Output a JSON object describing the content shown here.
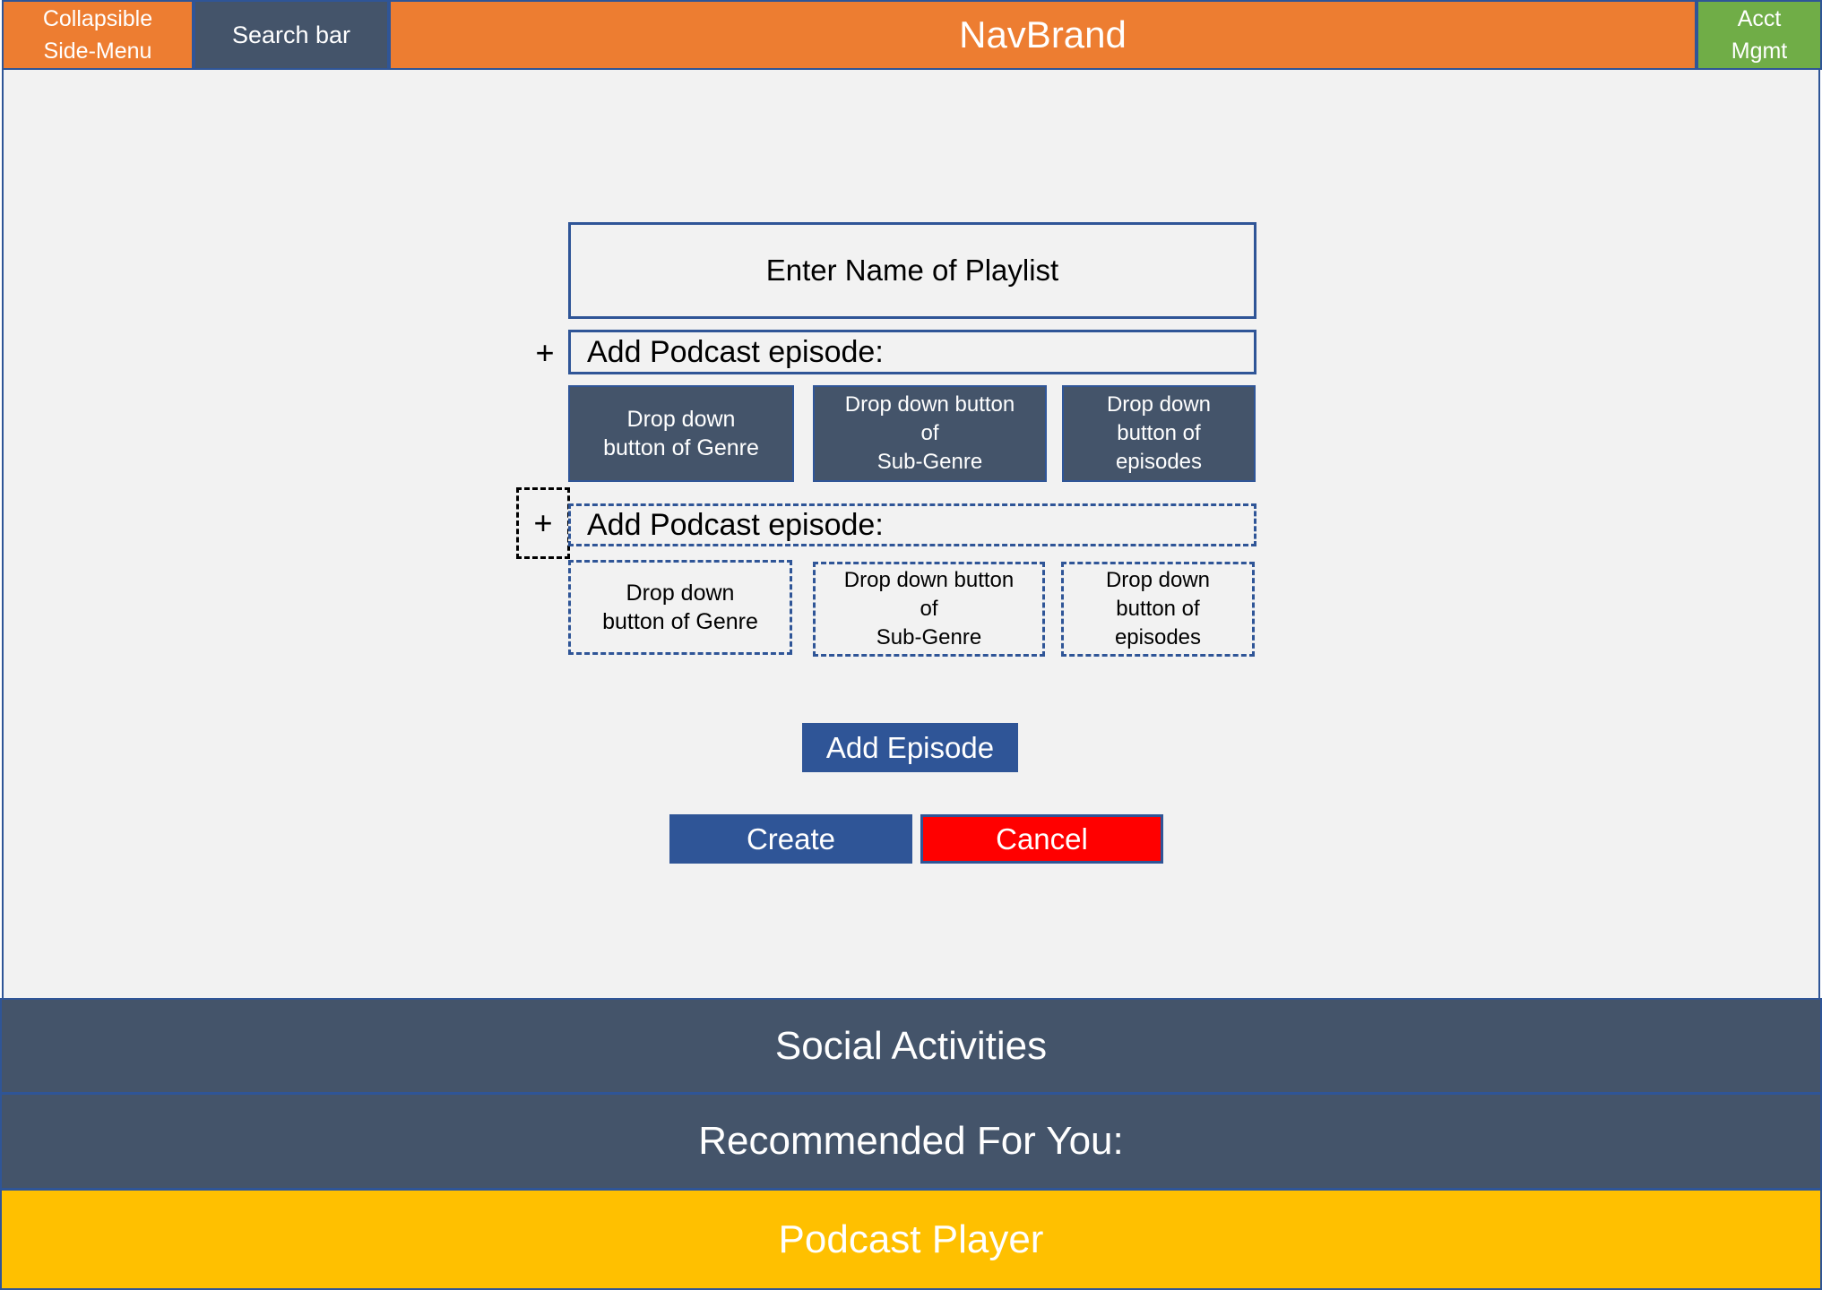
{
  "header": {
    "side_menu": "Collapsible\nSide-Menu",
    "search": "Search bar",
    "brand": "NavBrand",
    "account": "Acct\nMgmt"
  },
  "form": {
    "playlist_name_placeholder": "Enter Name of Playlist",
    "add_episode_label": "Add Podcast episode:",
    "plus_symbol": "+",
    "genre_dropdown": "Drop down\nbutton of Genre",
    "subgenre_dropdown": "Drop down button\nof\nSub-Genre",
    "episodes_dropdown": "Drop down\nbutton of\nepisodes",
    "add_episode_button": "Add Episode",
    "create_button": "Create",
    "cancel_button": "Cancel"
  },
  "footer": {
    "social": "Social Activities",
    "recommended": "Recommended For You:",
    "player": "Podcast Player"
  },
  "colors": {
    "nav_orange": "#ed7d31",
    "navy": "#44546a",
    "accent_blue": "#2f5597",
    "account_green": "#70ad47",
    "cancel_red": "#ff0000",
    "player_yellow": "#ffc000"
  }
}
